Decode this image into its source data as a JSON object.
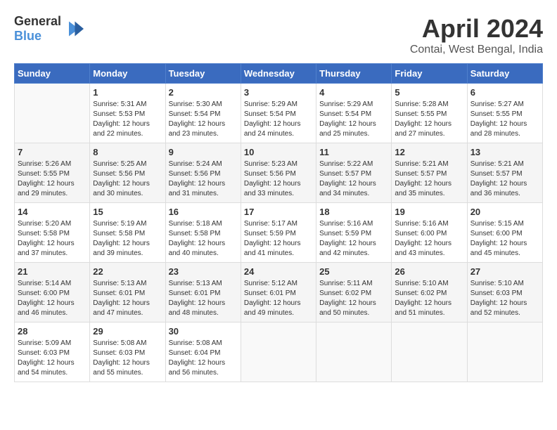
{
  "header": {
    "logo_general": "General",
    "logo_blue": "Blue",
    "month_year": "April 2024",
    "location": "Contai, West Bengal, India"
  },
  "weekdays": [
    "Sunday",
    "Monday",
    "Tuesday",
    "Wednesday",
    "Thursday",
    "Friday",
    "Saturday"
  ],
  "weeks": [
    [
      {
        "day": "",
        "sunrise": "",
        "sunset": "",
        "daylight": ""
      },
      {
        "day": "1",
        "sunrise": "Sunrise: 5:31 AM",
        "sunset": "Sunset: 5:53 PM",
        "daylight": "Daylight: 12 hours and 22 minutes."
      },
      {
        "day": "2",
        "sunrise": "Sunrise: 5:30 AM",
        "sunset": "Sunset: 5:54 PM",
        "daylight": "Daylight: 12 hours and 23 minutes."
      },
      {
        "day": "3",
        "sunrise": "Sunrise: 5:29 AM",
        "sunset": "Sunset: 5:54 PM",
        "daylight": "Daylight: 12 hours and 24 minutes."
      },
      {
        "day": "4",
        "sunrise": "Sunrise: 5:29 AM",
        "sunset": "Sunset: 5:54 PM",
        "daylight": "Daylight: 12 hours and 25 minutes."
      },
      {
        "day": "5",
        "sunrise": "Sunrise: 5:28 AM",
        "sunset": "Sunset: 5:55 PM",
        "daylight": "Daylight: 12 hours and 27 minutes."
      },
      {
        "day": "6",
        "sunrise": "Sunrise: 5:27 AM",
        "sunset": "Sunset: 5:55 PM",
        "daylight": "Daylight: 12 hours and 28 minutes."
      }
    ],
    [
      {
        "day": "7",
        "sunrise": "Sunrise: 5:26 AM",
        "sunset": "Sunset: 5:55 PM",
        "daylight": "Daylight: 12 hours and 29 minutes."
      },
      {
        "day": "8",
        "sunrise": "Sunrise: 5:25 AM",
        "sunset": "Sunset: 5:56 PM",
        "daylight": "Daylight: 12 hours and 30 minutes."
      },
      {
        "day": "9",
        "sunrise": "Sunrise: 5:24 AM",
        "sunset": "Sunset: 5:56 PM",
        "daylight": "Daylight: 12 hours and 31 minutes."
      },
      {
        "day": "10",
        "sunrise": "Sunrise: 5:23 AM",
        "sunset": "Sunset: 5:56 PM",
        "daylight": "Daylight: 12 hours and 33 minutes."
      },
      {
        "day": "11",
        "sunrise": "Sunrise: 5:22 AM",
        "sunset": "Sunset: 5:57 PM",
        "daylight": "Daylight: 12 hours and 34 minutes."
      },
      {
        "day": "12",
        "sunrise": "Sunrise: 5:21 AM",
        "sunset": "Sunset: 5:57 PM",
        "daylight": "Daylight: 12 hours and 35 minutes."
      },
      {
        "day": "13",
        "sunrise": "Sunrise: 5:21 AM",
        "sunset": "Sunset: 5:57 PM",
        "daylight": "Daylight: 12 hours and 36 minutes."
      }
    ],
    [
      {
        "day": "14",
        "sunrise": "Sunrise: 5:20 AM",
        "sunset": "Sunset: 5:58 PM",
        "daylight": "Daylight: 12 hours and 37 minutes."
      },
      {
        "day": "15",
        "sunrise": "Sunrise: 5:19 AM",
        "sunset": "Sunset: 5:58 PM",
        "daylight": "Daylight: 12 hours and 39 minutes."
      },
      {
        "day": "16",
        "sunrise": "Sunrise: 5:18 AM",
        "sunset": "Sunset: 5:58 PM",
        "daylight": "Daylight: 12 hours and 40 minutes."
      },
      {
        "day": "17",
        "sunrise": "Sunrise: 5:17 AM",
        "sunset": "Sunset: 5:59 PM",
        "daylight": "Daylight: 12 hours and 41 minutes."
      },
      {
        "day": "18",
        "sunrise": "Sunrise: 5:16 AM",
        "sunset": "Sunset: 5:59 PM",
        "daylight": "Daylight: 12 hours and 42 minutes."
      },
      {
        "day": "19",
        "sunrise": "Sunrise: 5:16 AM",
        "sunset": "Sunset: 6:00 PM",
        "daylight": "Daylight: 12 hours and 43 minutes."
      },
      {
        "day": "20",
        "sunrise": "Sunrise: 5:15 AM",
        "sunset": "Sunset: 6:00 PM",
        "daylight": "Daylight: 12 hours and 45 minutes."
      }
    ],
    [
      {
        "day": "21",
        "sunrise": "Sunrise: 5:14 AM",
        "sunset": "Sunset: 6:00 PM",
        "daylight": "Daylight: 12 hours and 46 minutes."
      },
      {
        "day": "22",
        "sunrise": "Sunrise: 5:13 AM",
        "sunset": "Sunset: 6:01 PM",
        "daylight": "Daylight: 12 hours and 47 minutes."
      },
      {
        "day": "23",
        "sunrise": "Sunrise: 5:13 AM",
        "sunset": "Sunset: 6:01 PM",
        "daylight": "Daylight: 12 hours and 48 minutes."
      },
      {
        "day": "24",
        "sunrise": "Sunrise: 5:12 AM",
        "sunset": "Sunset: 6:01 PM",
        "daylight": "Daylight: 12 hours and 49 minutes."
      },
      {
        "day": "25",
        "sunrise": "Sunrise: 5:11 AM",
        "sunset": "Sunset: 6:02 PM",
        "daylight": "Daylight: 12 hours and 50 minutes."
      },
      {
        "day": "26",
        "sunrise": "Sunrise: 5:10 AM",
        "sunset": "Sunset: 6:02 PM",
        "daylight": "Daylight: 12 hours and 51 minutes."
      },
      {
        "day": "27",
        "sunrise": "Sunrise: 5:10 AM",
        "sunset": "Sunset: 6:03 PM",
        "daylight": "Daylight: 12 hours and 52 minutes."
      }
    ],
    [
      {
        "day": "28",
        "sunrise": "Sunrise: 5:09 AM",
        "sunset": "Sunset: 6:03 PM",
        "daylight": "Daylight: 12 hours and 54 minutes."
      },
      {
        "day": "29",
        "sunrise": "Sunrise: 5:08 AM",
        "sunset": "Sunset: 6:03 PM",
        "daylight": "Daylight: 12 hours and 55 minutes."
      },
      {
        "day": "30",
        "sunrise": "Sunrise: 5:08 AM",
        "sunset": "Sunset: 6:04 PM",
        "daylight": "Daylight: 12 hours and 56 minutes."
      },
      {
        "day": "",
        "sunrise": "",
        "sunset": "",
        "daylight": ""
      },
      {
        "day": "",
        "sunrise": "",
        "sunset": "",
        "daylight": ""
      },
      {
        "day": "",
        "sunrise": "",
        "sunset": "",
        "daylight": ""
      },
      {
        "day": "",
        "sunrise": "",
        "sunset": "",
        "daylight": ""
      }
    ]
  ]
}
